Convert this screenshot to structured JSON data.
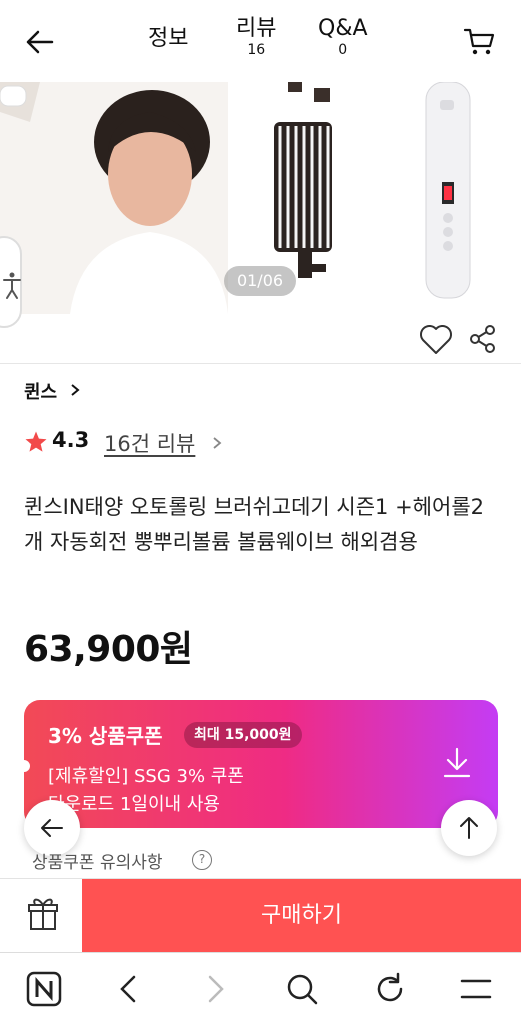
{
  "header": {
    "tabs": [
      {
        "label": "정보",
        "count": ""
      },
      {
        "label": "리뷰",
        "count": "16"
      },
      {
        "label": "Q&A",
        "count": "0"
      }
    ]
  },
  "gallery": {
    "page_indicator": "01/06"
  },
  "product": {
    "brand": "퀸스",
    "rating": "4.3",
    "review_link": "16건 리뷰",
    "title": "퀸스IN태양 오토롤링 브러쉬고데기 시즌1 +헤어롤2개 자동회전 뿡뿌리볼륨 볼륨웨이브 해외겸용",
    "price": "63,900원"
  },
  "coupon": {
    "title": "3% 상품쿠폰",
    "badge": "최대 15,000원",
    "line1": "[제휴할인] SSG 3% 쿠폰",
    "line2": "다운로드 1일이내 사용",
    "notice": "상품쿠폰 유의사항",
    "info_glyph": "?"
  },
  "purchase_bar": {
    "buy_label": "구매하기"
  },
  "colors": {
    "accent": "#ff5252",
    "star": "#f24a4a",
    "coupon_gradient_start": "#f24a56",
    "coupon_gradient_end": "#c43cf4"
  },
  "icons": {
    "back": "arrow-left-icon",
    "cart": "cart-icon",
    "heart": "heart-icon",
    "share": "share-icon",
    "download": "download-icon",
    "gift": "gift-icon",
    "accessibility": "accessibility-icon",
    "browser_nav": [
      "naver-home-icon",
      "back-chevron-icon",
      "forward-chevron-icon",
      "search-icon",
      "refresh-icon",
      "menu-icon"
    ]
  }
}
